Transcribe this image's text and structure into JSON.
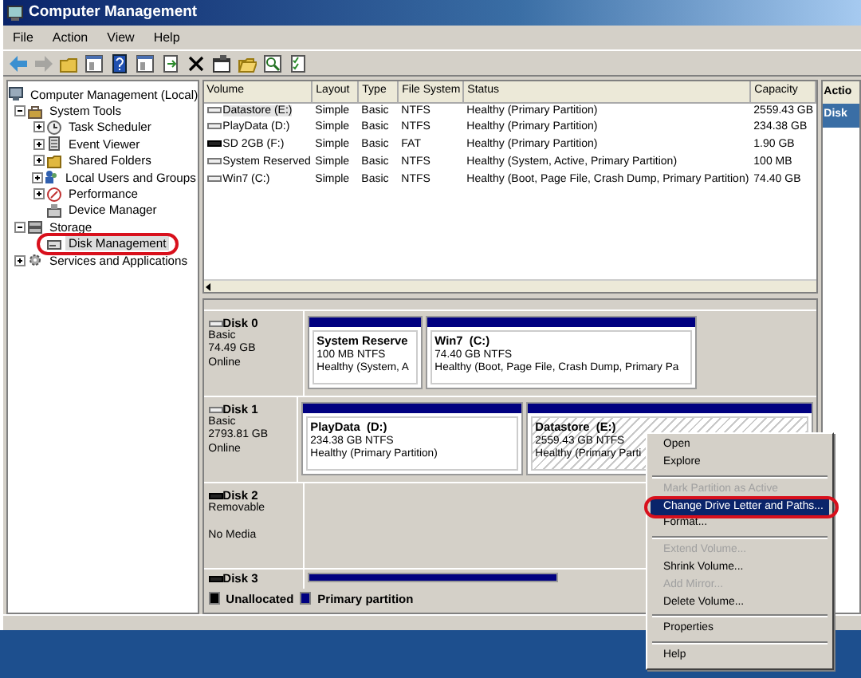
{
  "window": {
    "title": "Computer Management"
  },
  "menu": [
    "File",
    "Action",
    "View",
    "Help"
  ],
  "toolbar": [
    {
      "kind": "back",
      "disabled": false
    },
    {
      "kind": "forward",
      "disabled": true
    },
    {
      "kind": "up",
      "disabled": false
    },
    {
      "kind": "pane",
      "disabled": false
    },
    {
      "kind": "help",
      "disabled": false
    },
    {
      "kind": "pane",
      "disabled": false
    },
    {
      "kind": "export",
      "disabled": false
    },
    {
      "kind": "delete",
      "disabled": false
    },
    {
      "kind": "properties",
      "disabled": false
    },
    {
      "kind": "open",
      "disabled": false
    },
    {
      "kind": "search",
      "disabled": false
    },
    {
      "kind": "check",
      "disabled": false
    }
  ],
  "tree": [
    {
      "label": "Computer Management (Local)",
      "selected": false,
      "circled": false,
      "children": [
        {
          "label": "System Tools",
          "expanded": true,
          "selected": false,
          "circled": false,
          "children": [
            {
              "label": "Task Scheduler",
              "expanded": false,
              "selected": false,
              "circled": false
            },
            {
              "label": "Event Viewer",
              "expanded": false,
              "selected": false,
              "circled": false
            },
            {
              "label": "Shared Folders",
              "expanded": false,
              "selected": false,
              "circled": false
            },
            {
              "label": "Local Users and Groups",
              "expanded": false,
              "selected": false,
              "circled": false
            },
            {
              "label": "Performance",
              "expanded": false,
              "selected": false,
              "circled": false
            },
            {
              "label": "Device Manager",
              "selected": false,
              "circled": false
            }
          ]
        },
        {
          "label": "Storage",
          "expanded": true,
          "selected": false,
          "circled": false,
          "children": [
            {
              "label": "Disk Management",
              "selected": true,
              "circled": true
            }
          ]
        },
        {
          "label": "Services and Applications",
          "expanded": false,
          "selected": false,
          "circled": false
        }
      ]
    }
  ],
  "volumes": {
    "columns": [
      "Volume",
      "Layout",
      "Type",
      "File System",
      "Status",
      "Capacity"
    ],
    "rows": [
      {
        "kind": "fixed",
        "selected": true,
        "cells": [
          "Datastore (E:)",
          "Simple",
          "Basic",
          "NTFS",
          "Healthy (Primary Partition)",
          "2559.43 GB"
        ]
      },
      {
        "kind": "fixed",
        "selected": false,
        "cells": [
          "PlayData (D:)",
          "Simple",
          "Basic",
          "NTFS",
          "Healthy (Primary Partition)",
          "234.38 GB"
        ]
      },
      {
        "kind": "removable",
        "selected": false,
        "cells": [
          "SD 2GB (F:)",
          "Simple",
          "Basic",
          "FAT",
          "Healthy (Primary Partition)",
          "1.90 GB"
        ]
      },
      {
        "kind": "fixed",
        "selected": false,
        "cells": [
          "System Reserved",
          "Simple",
          "Basic",
          "NTFS",
          "Healthy (System, Active, Primary Partition)",
          "100 MB"
        ]
      },
      {
        "kind": "fixed",
        "selected": false,
        "cells": [
          "Win7 (C:)",
          "Simple",
          "Basic",
          "NTFS",
          "Healthy (Boot, Page File, Crash Dump, Primary Partition)",
          "74.40 GB"
        ]
      }
    ]
  },
  "disks": [
    {
      "name": "Disk 0",
      "kind": "fixed",
      "type": "Basic",
      "size": "74.49 GB",
      "status": "Online",
      "partitions": [
        {
          "name": "System Reserve",
          "size": "100 MB NTFS",
          "status": "Healthy (System, A",
          "selected": false
        },
        {
          "name": "Win7  (C:)",
          "size": "74.40 GB NTFS",
          "status": "Healthy (Boot, Page File, Crash Dump, Primary Pa",
          "selected": false
        }
      ]
    },
    {
      "name": "Disk 1",
      "kind": "fixed",
      "type": "Basic",
      "size": "2793.81 GB",
      "status": "Online",
      "partitions": [
        {
          "name": "PlayData  (D:)",
          "size": "234.38 GB NTFS",
          "status": "Healthy (Primary Partition)",
          "selected": false
        },
        {
          "name": "Datastore  (E:)",
          "size": "2559.43 GB NTFS",
          "status": "Healthy (Primary Parti",
          "selected": true
        }
      ]
    },
    {
      "name": "Disk 2",
      "kind": "removable",
      "type": "Removable",
      "status": "No Media"
    },
    {
      "name": "Disk 3",
      "kind": "removable",
      "partitions": [
        {
          "selected": false
        }
      ]
    }
  ],
  "legend": [
    {
      "label": "Unallocated",
      "color": "#000000"
    },
    {
      "label": "Primary partition",
      "color": "#000080"
    }
  ],
  "actions": {
    "title": "Actio",
    "items": [
      {
        "label": "Disk",
        "selected": true
      }
    ]
  },
  "context_menu": [
    {
      "kind": "item",
      "label": "Open",
      "disabled": false,
      "selected": false,
      "circled": false
    },
    {
      "kind": "item",
      "label": "Explore",
      "disabled": false,
      "selected": false,
      "circled": false
    },
    {
      "kind": "separator"
    },
    {
      "kind": "item",
      "label": "Mark Partition as Active",
      "disabled": true,
      "selected": false,
      "circled": false
    },
    {
      "kind": "item",
      "label": "Change Drive Letter and Paths...",
      "disabled": false,
      "selected": true,
      "circled": true
    },
    {
      "kind": "item",
      "label": "Format...",
      "disabled": false,
      "selected": false,
      "circled": false
    },
    {
      "kind": "separator"
    },
    {
      "kind": "item",
      "label": "Extend Volume...",
      "disabled": true,
      "selected": false,
      "circled": false
    },
    {
      "kind": "item",
      "label": "Shrink Volume...",
      "disabled": false,
      "selected": false,
      "circled": false
    },
    {
      "kind": "item",
      "label": "Add Mirror...",
      "disabled": true,
      "selected": false,
      "circled": false
    },
    {
      "kind": "item",
      "label": "Delete Volume...",
      "disabled": false,
      "selected": false,
      "circled": false
    },
    {
      "kind": "separator"
    },
    {
      "kind": "item",
      "label": "Properties",
      "disabled": false,
      "selected": false,
      "circled": false
    },
    {
      "kind": "separator"
    },
    {
      "kind": "item",
      "label": "Help",
      "disabled": false,
      "selected": false,
      "circled": false
    }
  ]
}
